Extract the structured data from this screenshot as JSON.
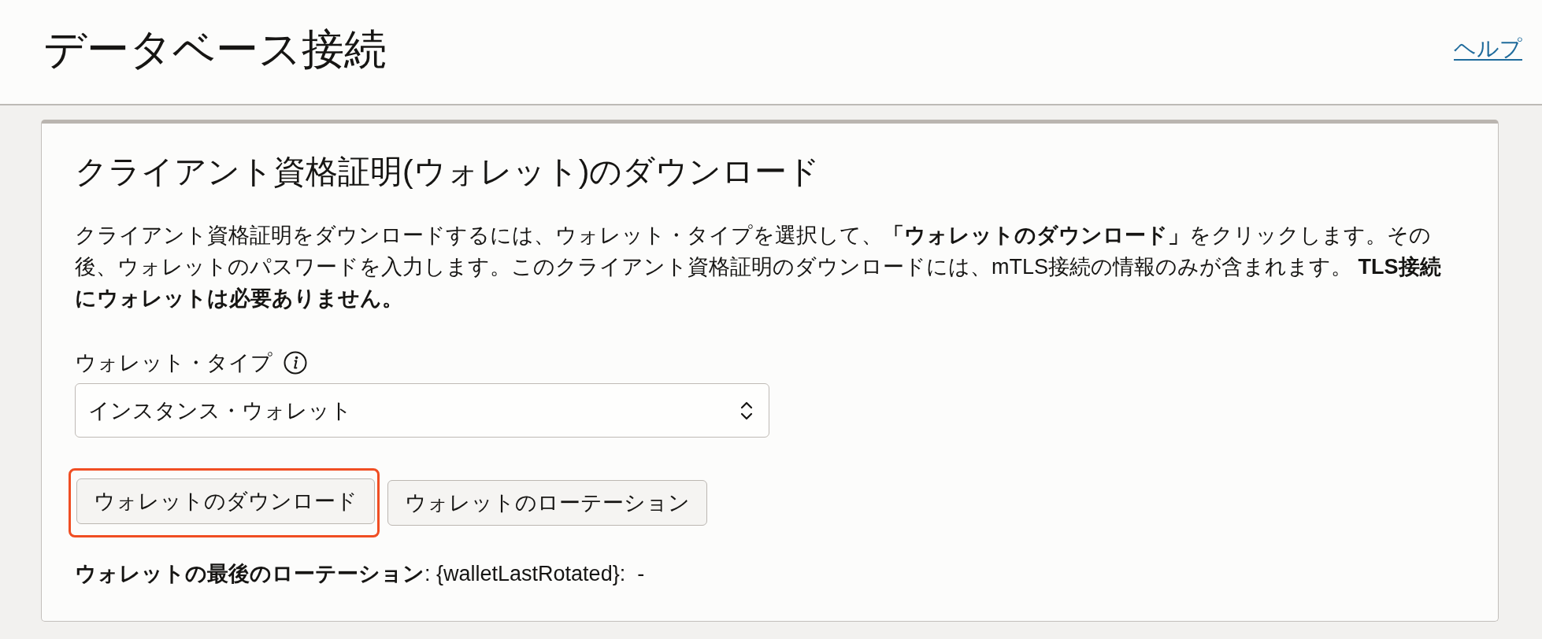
{
  "header": {
    "title": "データベース接続",
    "help_link": "ヘルプ"
  },
  "panel": {
    "title": "クライアント資格証明(ウォレット)のダウンロード",
    "description": "クライアント資格証明をダウンロードするには、ウォレット・タイプを選択して、**「ウォレットのダウンロード」**をクリックします。その後、ウォレットのパスワードを入力します。このクライアント資格証明のダウンロードには、mTLS接続の情報のみが含まれます。 **TLS接続にウォレットは必要ありません。**",
    "wallet_type": {
      "label": "ウォレット・タイプ",
      "value": "インスタンス・ウォレット"
    },
    "buttons": [
      {
        "label": "ウォレットのダウンロード",
        "highlighted": true
      },
      {
        "label": "ウォレットのローテーション",
        "highlighted": false
      }
    ],
    "last_rotated": "**ウォレットの最後のローテーション**: {walletLastRotated}:  -"
  }
}
